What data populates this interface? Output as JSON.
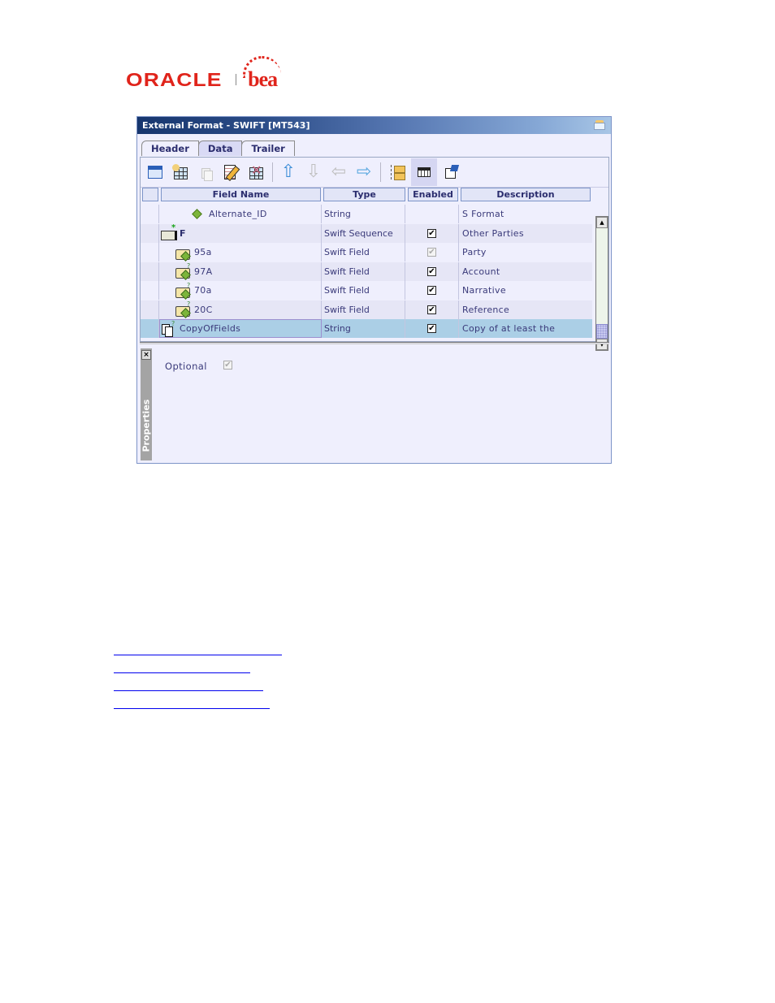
{
  "logo": {
    "oracle": "ORACLE",
    "bea": "bea"
  },
  "window": {
    "title": "External Format - SWIFT [MT543]",
    "title_icon": "envelope-icon"
  },
  "tabs": [
    {
      "label": "Header",
      "active": false
    },
    {
      "label": "Data",
      "active": true
    },
    {
      "label": "Trailer",
      "active": false
    }
  ],
  "toolbar": [
    {
      "name": "new-table-icon",
      "enabled": true
    },
    {
      "name": "add-row-icon",
      "enabled": true
    },
    {
      "name": "copy-icon",
      "enabled": false
    },
    {
      "name": "edit-icon",
      "enabled": true
    },
    {
      "name": "delete-row-icon",
      "enabled": true
    },
    {
      "name": "move-up-icon",
      "enabled": true
    },
    {
      "name": "move-down-icon",
      "enabled": false
    },
    {
      "name": "move-left-icon",
      "enabled": false
    },
    {
      "name": "move-right-icon",
      "enabled": true
    },
    {
      "name": "tree-view-icon",
      "enabled": true
    },
    {
      "name": "table-view-icon",
      "enabled": true,
      "pressed": true
    },
    {
      "name": "properties-icon",
      "enabled": true
    }
  ],
  "grid": {
    "columns": [
      "Field Name",
      "Type",
      "Enabled",
      "Description"
    ],
    "rows": [
      {
        "name": "Alternate_ID",
        "icon": "diamond-icon",
        "type": "String",
        "enabled": null,
        "description": "S Format",
        "indent": 2
      },
      {
        "name": "F",
        "icon": "sequence-icon",
        "type": "Swift Sequence",
        "enabled": "checked",
        "description": "Other Parties",
        "indent": 0
      },
      {
        "name": "95a",
        "icon": "field-folder-icon",
        "type": "Swift Field",
        "enabled": "checked-disabled",
        "description": "Party",
        "indent": 1
      },
      {
        "name": "97A",
        "icon": "field-folder-optional-icon",
        "type": "Swift Field",
        "enabled": "checked",
        "description": "Account",
        "indent": 1
      },
      {
        "name": "70a",
        "icon": "field-folder-optional-icon",
        "type": "Swift Field",
        "enabled": "checked",
        "description": "Narrative",
        "indent": 1
      },
      {
        "name": "20C",
        "icon": "field-folder-optional-icon",
        "type": "Swift Field",
        "enabled": "checked",
        "description": "Reference",
        "indent": 1
      },
      {
        "name": "CopyOfFields",
        "icon": "copy-fields-icon",
        "type": "String",
        "enabled": "checked",
        "description": "Copy of at least the",
        "indent": 0,
        "selected": true
      }
    ]
  },
  "properties": {
    "panel_label": "Properties",
    "close_label": "×",
    "optional_label": "Optional",
    "optional_checked": true,
    "optional_disabled": true
  },
  "links": [
    "",
    "",
    "",
    ""
  ],
  "checkmark": "✔"
}
